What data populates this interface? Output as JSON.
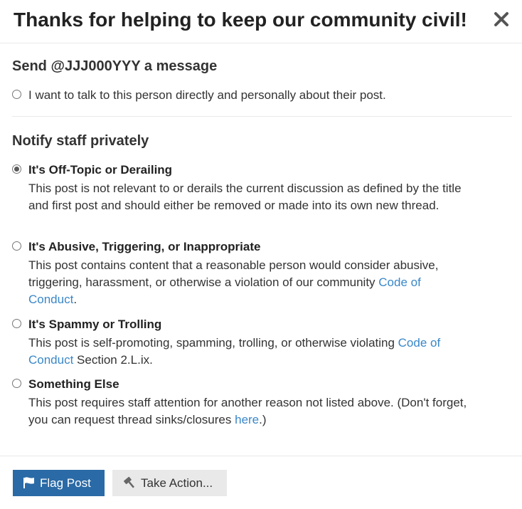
{
  "header": {
    "title": "Thanks for helping to keep our community civil!",
    "close_icon": "close-icon"
  },
  "message_section": {
    "title": "Send @JJJ000YYY a message",
    "option": {
      "label": "I want to talk to this person directly and personally about their post.",
      "selected": false
    }
  },
  "notify_section": {
    "title": "Notify staff privately",
    "options": [
      {
        "label": "It's Off-Topic or Derailing",
        "desc": "This post is not relevant to or derails the current discussion as defined by the title and first post and should either be removed or made into its own new thread.",
        "selected": true
      },
      {
        "label": "It's Abusive, Triggering, or Inappropriate",
        "desc_before": "This post contains content that a reasonable person would consider abusive, triggering, harassment, or otherwise a violation of our community ",
        "link": "Code of Conduct",
        "desc_after": ".",
        "selected": false
      },
      {
        "label": "It's Spammy or Trolling",
        "desc_before": "This post is self-promoting, spamming, trolling, or otherwise violating ",
        "link": "Code of Conduct",
        "desc_after": " Section 2.L.ix.",
        "selected": false
      },
      {
        "label": "Something Else",
        "desc_before": "This post requires staff attention for another reason not listed above. (Don't forget, you can request thread sinks/closures ",
        "link": "here",
        "desc_after": ".)",
        "selected": false
      }
    ]
  },
  "footer": {
    "flag_button": "Flag Post",
    "flag_icon": "flag-icon",
    "action_button": "Take Action...",
    "action_icon": "gavel-icon"
  },
  "colors": {
    "primary": "#2a6aa6",
    "link": "#3a87c8",
    "secondary_bg": "#e9e9e9"
  }
}
